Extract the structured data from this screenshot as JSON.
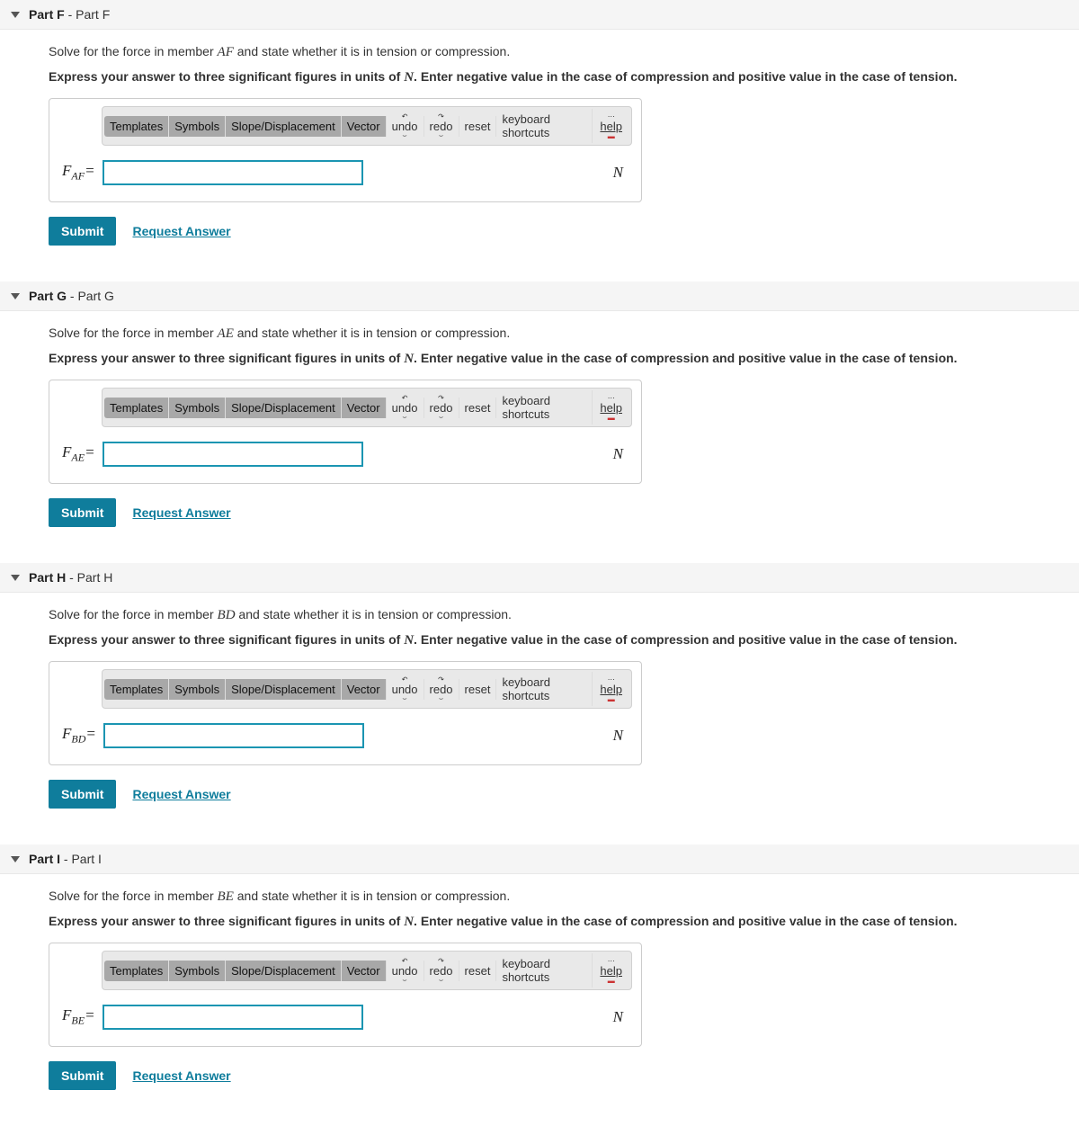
{
  "toolbar_labels": {
    "templates": "Templates",
    "symbols": "Symbols",
    "slope": "Slope/Displacement",
    "vector": "Vector",
    "undo": "undo",
    "redo": "redo",
    "reset": "reset",
    "shortcuts": "keyboard shortcuts",
    "help": "help"
  },
  "actions": {
    "submit": "Submit",
    "request": "Request Answer"
  },
  "common": {
    "instructions_prefix": "Express your answer to three significant figures in units of ",
    "instructions_unit": "N",
    "instructions_suffix": ". Enter negative value in the case of compression and positive value in the case of tension.",
    "unit": "N",
    "prompt_prefix": "Solve for the force in member ",
    "prompt_suffix": " and state whether it is in tension or compression."
  },
  "parts": [
    {
      "header_bold": "Part F",
      "header_rest": " - Part F",
      "member": "AF",
      "label_main": "F",
      "label_sub": "AF",
      "label_eq": "="
    },
    {
      "header_bold": "Part G",
      "header_rest": " - Part G",
      "member": "AE",
      "label_main": "F",
      "label_sub": "AE",
      "label_eq": "="
    },
    {
      "header_bold": "Part H",
      "header_rest": " - Part H",
      "member": "BD",
      "label_main": "F",
      "label_sub": "BD",
      "label_eq": "="
    },
    {
      "header_bold": "Part I",
      "header_rest": " - Part I",
      "member": "BE",
      "label_main": "F",
      "label_sub": "BE",
      "label_eq": "="
    }
  ]
}
